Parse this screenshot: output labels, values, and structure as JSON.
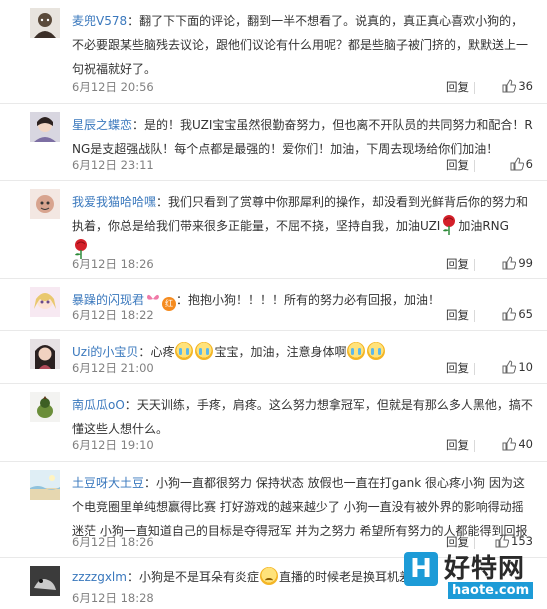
{
  "comments": [
    {
      "name": "麦兜V578",
      "text": "翻了下下面的评论，翻到一半不想看了。说真的，真正真心喜欢小狗的，不必要跟某些脑残去议论，跟他们议论有什么用呢？都是些脑子被门挤的，默默送上一句祝福就好了。",
      "date": "6月12日 20:56",
      "reply": "回复",
      "likes": "36"
    },
    {
      "name": "星辰之蝶恋",
      "text": "是的！我UZI宝宝虽然很勤奋努力，但也离不开队员的共同努力和配合！RNG是支超强战队！每个点都是最强的！爱你们！加油，下周去现场给你们加油！",
      "date": "6月12日 23:11",
      "reply": "回复",
      "likes": "6"
    },
    {
      "name": "我爱我猫哈哈嘿",
      "text_a": "我们只看到了赏尊中你那犀利的操作，却没看到光鲜背后你的努力和执着，你总是给我们带来很多正能量，不屈不挠，坚持自我，加油UZI",
      "text_b": "加油RNG",
      "date": "6月12日 18:26",
      "reply": "回复",
      "likes": "99"
    },
    {
      "name": "暴躁的闪现君",
      "badge": "红",
      "text": "抱抱小狗！！！！所有的努力必有回报，加油！",
      "date": "6月12日 18:22",
      "reply": "回复",
      "likes": "65"
    },
    {
      "name": "Uzi的小宝贝",
      "text_a": "心疼",
      "text_b": "宝宝，加油，注意身体啊",
      "date": "6月12日 21:00",
      "reply": "回复",
      "likes": "10"
    },
    {
      "name": "南瓜瓜oO",
      "text": "天天训练，手疼，肩疼。这么努力想拿冠军，但就是有那么多人黑他，搞不懂这些人想什么。",
      "date": "6月12日 19:10",
      "reply": "回复",
      "likes": "40"
    },
    {
      "name": "土豆呀大土豆",
      "text": "小狗一直都很努力 保持状态 放假也一直在打gank 很心疼小狗 因为这个电竞圈里单纯想赢得比赛 打好游戏的越来越少了 小狗一直没有被外界的影响得动摇迷茫 小狗一直知道自己的目标是夺得冠军 并为之努力 希望所有努力的人都能得到回报",
      "date": "6月12日 18:26",
      "reply": "回复",
      "likes": "153"
    },
    {
      "name": "zzzzgxlm",
      "text_a": "小狗是不是耳朵有炎症",
      "text_b": "直播的时候老是换耳机差",
      "date": "6月12日 18:28",
      "reply": "回复",
      "likes": ""
    }
  ],
  "watermark": {
    "logo_char": "H",
    "title": "好特网",
    "url": "haote.com"
  },
  "colors": {
    "name_orange": "#eb7350",
    "name_blue": "#3a78bd",
    "date_gray": "#808080",
    "divider": "#e9e9e9",
    "watermark_blue": "#1d9bd7"
  }
}
